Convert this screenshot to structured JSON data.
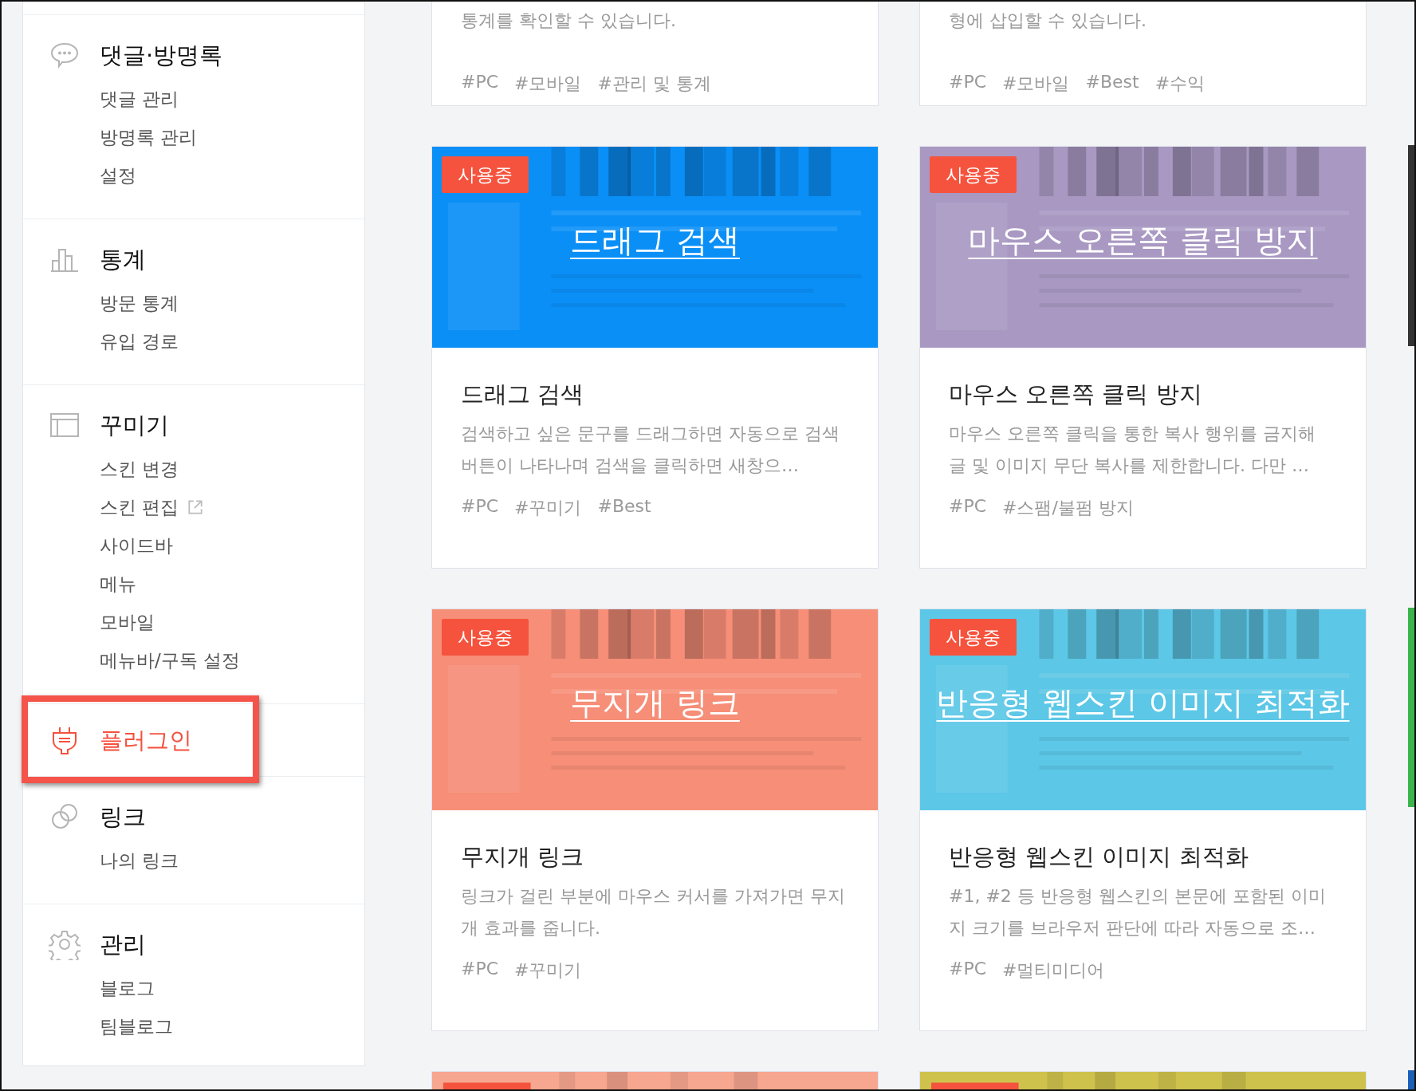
{
  "sidebar": {
    "sections": [
      {
        "kind": "comments",
        "title": "댓글·방명록",
        "selected": false,
        "items": [
          {
            "label": "댓글 관리",
            "external": false
          },
          {
            "label": "방명록 관리",
            "external": false
          },
          {
            "label": "설정",
            "external": false
          }
        ]
      },
      {
        "kind": "stats",
        "title": "통계",
        "selected": false,
        "items": [
          {
            "label": "방문 통계",
            "external": false
          },
          {
            "label": "유입 경로",
            "external": false
          }
        ]
      },
      {
        "kind": "design",
        "title": "꾸미기",
        "selected": false,
        "items": [
          {
            "label": "스킨 변경",
            "external": false
          },
          {
            "label": "스킨 편집",
            "external": true
          },
          {
            "label": "사이드바",
            "external": false
          },
          {
            "label": "메뉴",
            "external": false
          },
          {
            "label": "모바일",
            "external": false
          },
          {
            "label": "메뉴바/구독 설정",
            "external": false
          }
        ]
      },
      {
        "kind": "plugin",
        "title": "플러그인",
        "selected": true
      },
      {
        "kind": "link",
        "title": "링크",
        "selected": false,
        "items": [
          {
            "label": "나의 링크",
            "external": false
          }
        ]
      },
      {
        "kind": "manage",
        "title": "관리",
        "selected": false,
        "items": [
          {
            "label": "블로그",
            "external": false
          },
          {
            "label": "팀블로그",
            "external": false
          }
        ]
      }
    ]
  },
  "cards": [
    {
      "kind": "cut-top",
      "description": "통계를 확인할 수 있습니다.",
      "tags": [
        "#PC",
        "#모바일",
        "#관리 및 통계"
      ]
    },
    {
      "kind": "cut-top",
      "description": "형에 삽입할 수 있습니다.",
      "tags": [
        "#PC",
        "#모바일",
        "#Best",
        "#수익"
      ]
    },
    {
      "kind": "full",
      "badge": "사용중",
      "color": "#0a8ff7",
      "image_title": "드래그 검색",
      "title": "드래그 검색",
      "description": "검색하고 싶은 문구를 드래그하면 자동으로 검색 버튼이 나타나며 검색을 클릭하면 새창으…",
      "tags": [
        "#PC",
        "#꾸미기",
        "#Best"
      ]
    },
    {
      "kind": "full",
      "badge": "사용중",
      "color": "#a898c2",
      "image_title": "마우스 오른쪽 클릭 방지",
      "title": "마우스 오른쪽 클릭 방지",
      "description": "마우스 오른쪽 클릭을 통한 복사 행위를 금지해 글 및 이미지 무단 복사를 제한합니다. 다만 …",
      "tags": [
        "#PC",
        "#스팸/불펌 방지"
      ]
    },
    {
      "kind": "full",
      "badge": "사용중",
      "color": "#f68e78",
      "image_title": "무지개 링크",
      "title": "무지개 링크",
      "description": "링크가 걸린 부분에 마우스 커서를 가져가면 무지개 효과를 줍니다.",
      "tags": [
        "#PC",
        "#꾸미기"
      ]
    },
    {
      "kind": "full",
      "badge": "사용중",
      "color": "#5cc7e6",
      "image_title": "반응형 웹스킨 이미지 최적화",
      "title": "반응형 웹스킨 이미지 최적화",
      "description": "#1, #2 등 반응형 웹스킨의 본문에 포함된 이미지 크기를 브라우저 판단에 따라 자동으로 조…",
      "tags": [
        "#PC",
        "#멀티미디어"
      ]
    },
    {
      "kind": "cut-bottom",
      "color": "#f7a690"
    },
    {
      "kind": "cut-bottom",
      "color": "#cfc24c"
    }
  ]
}
